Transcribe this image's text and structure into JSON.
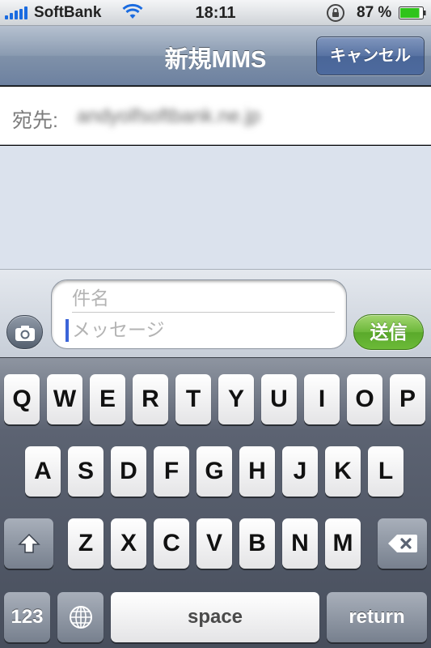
{
  "status_bar": {
    "carrier": "SoftBank",
    "time": "18:11",
    "battery_percent": "87 %",
    "battery_level": 0.87,
    "signal_bars": 5,
    "icons": [
      "signal-bars-icon",
      "wifi-icon",
      "rotation-lock-icon",
      "battery-icon"
    ]
  },
  "nav": {
    "title": "新規MMS",
    "cancel_label": "キャンセル"
  },
  "recipient": {
    "label": "宛先:",
    "value": "andyolfsoftbank.ne.jp"
  },
  "compose": {
    "subject_placeholder": "件名",
    "message_placeholder": "メッセージ",
    "send_label": "送信"
  },
  "keyboard": {
    "row1": [
      "Q",
      "W",
      "E",
      "R",
      "T",
      "Y",
      "U",
      "I",
      "O",
      "P"
    ],
    "row2": [
      "A",
      "S",
      "D",
      "F",
      "G",
      "H",
      "J",
      "K",
      "L"
    ],
    "row3": [
      "Z",
      "X",
      "C",
      "V",
      "B",
      "N",
      "M"
    ],
    "numbers_label": "123",
    "space_label": "space",
    "return_label": "return"
  },
  "colors": {
    "nav_tint": "#6d81a0",
    "send_green": "#5aa92b",
    "caret_blue": "#3b64d8",
    "signal_blue": "#1a6be0",
    "battery_green": "#2fc41a"
  }
}
